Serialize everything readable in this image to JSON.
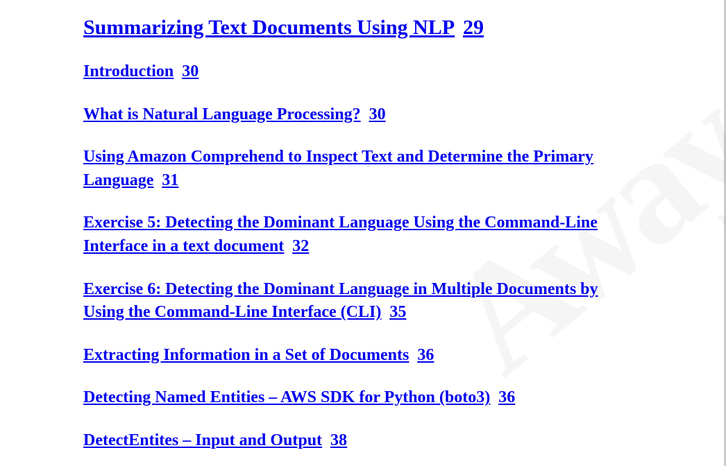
{
  "watermark": "Away",
  "chapter": {
    "title": "Summarizing Text Documents Using NLP",
    "page": "29"
  },
  "entries": [
    {
      "title": "Introduction",
      "page": "30"
    },
    {
      "title": "What is Natural Language Processing?",
      "page": "30"
    },
    {
      "title": "Using Amazon Comprehend to Inspect Text and Determine the Primary Language",
      "page": "31"
    },
    {
      "title": "Exercise 5: Detecting the Dominant Language Using the Command-Line Interface in a text document",
      "page": "32"
    },
    {
      "title": "Exercise 6: Detecting the Dominant Language in Multiple Documents by Using the Command-Line Interface (CLI)",
      "page": "35"
    },
    {
      "title": "Extracting Information in a Set of Documents",
      "page": "36"
    },
    {
      "title": "Detecting Named Entities – AWS SDK for Python (boto3)",
      "page": "36"
    },
    {
      "title": "DetectEntites – Input and Output",
      "page": "38"
    }
  ]
}
